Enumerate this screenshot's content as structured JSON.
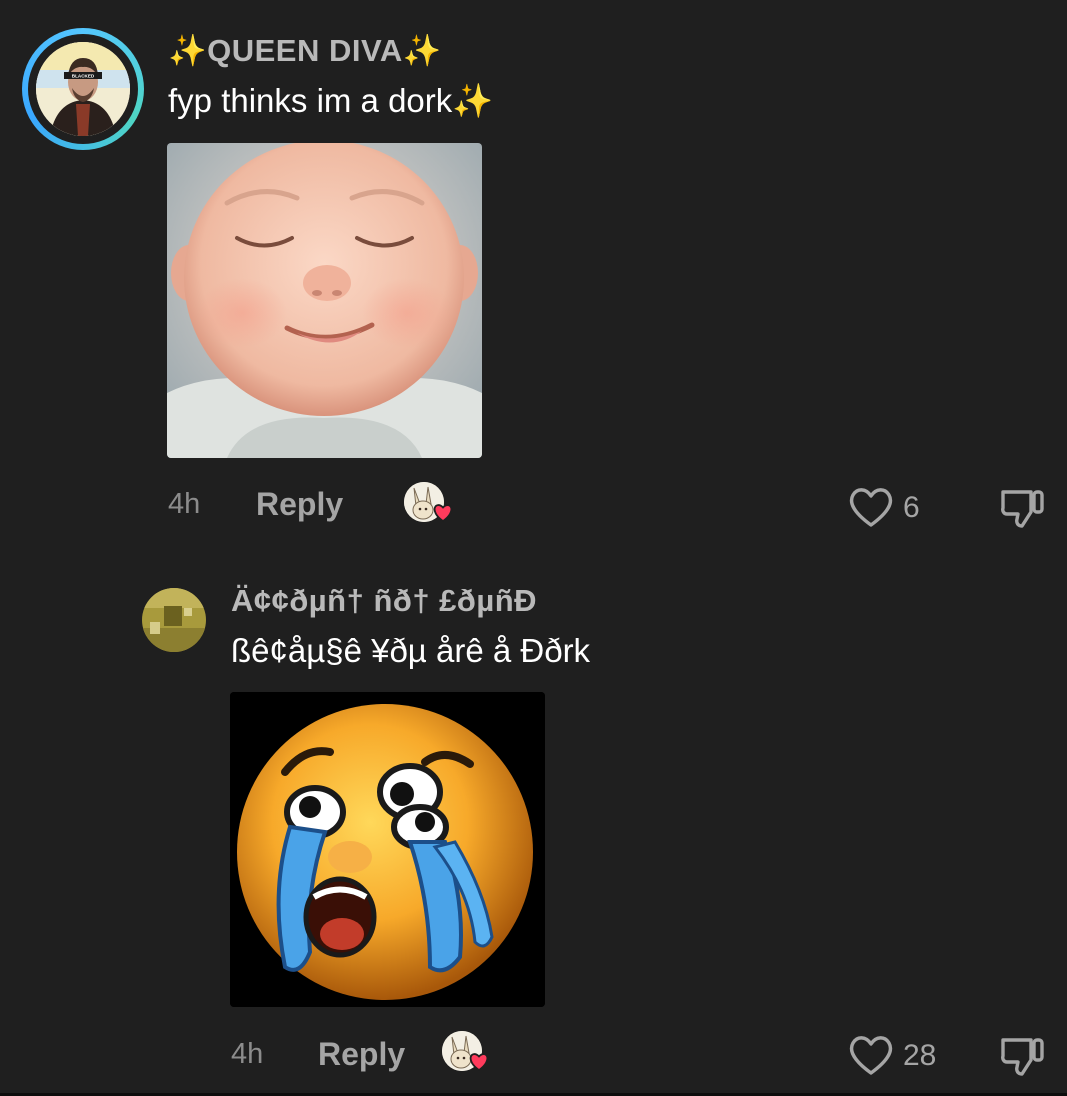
{
  "comments": [
    {
      "username": "✨QUEEN DIVA✨",
      "text": "fyp thinks im a dork✨",
      "time": "4h",
      "reply_label": "Reply",
      "likes": "6"
    },
    {
      "username": "Ä¢¢ðµñ† ñð† £ðµñÐ",
      "text": "ßê¢åµ§ê ¥ðµ årê å Ððrk",
      "time": "4h",
      "reply_label": "Reply",
      "likes": "28"
    }
  ],
  "colors": {
    "background": "#1f1f1f",
    "username": "#b9b9b9",
    "meta": "#8c8c8c",
    "ring": "#4fd6c4",
    "heart_badge": "#ff3b5c"
  },
  "icons": [
    "heart-outline-icon",
    "dislike-icon",
    "sparkles-icon",
    "liked-by-creator-avatar"
  ]
}
